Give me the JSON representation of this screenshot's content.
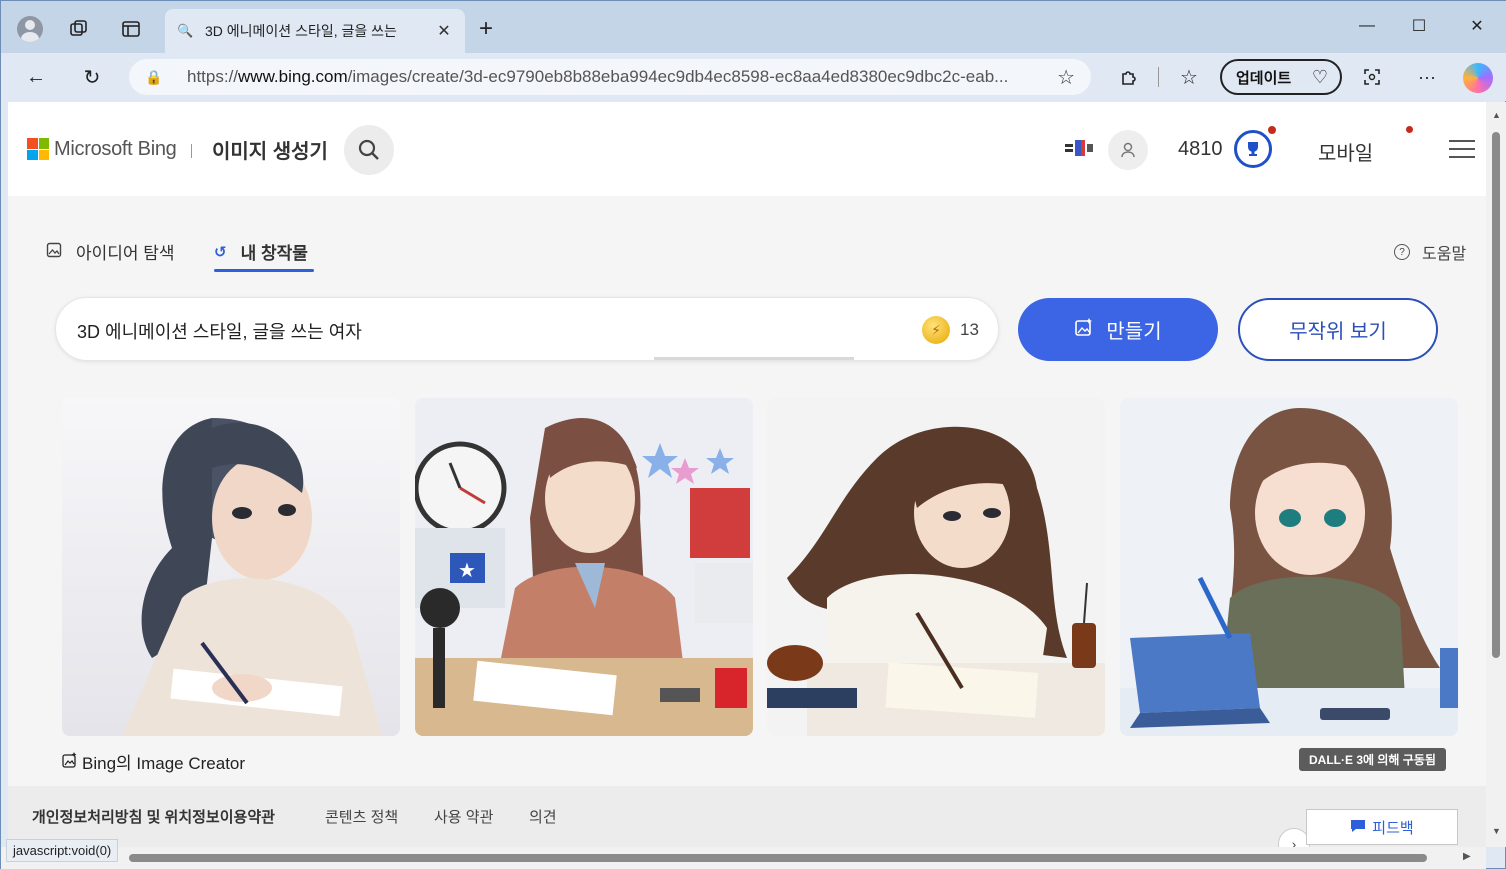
{
  "browser": {
    "tab_title": "3D 에니메이션 스타일, 글을 쓰는",
    "url_prefix": "https://",
    "url_domain": "www.bing.com",
    "url_rest": "/images/create/3d-ec9790eb8b88eba994ec9db4ec8598-ec8aa4ed8380ec9dbc2c-eab...",
    "update_label": "업데이트",
    "status_text": "javascript:void(0)"
  },
  "header": {
    "brand": "Microsoft Bing",
    "product": "이미지 생성기",
    "points": "4810",
    "mobile": "모바일"
  },
  "subnav": {
    "explore": "아이디어 탐색",
    "creations": "내 창작물",
    "help": "도움말"
  },
  "prompt": {
    "text": "3D 에니메이션 스타일, 글을 쓰는 여자",
    "boosts": "13",
    "create_label": "만들기",
    "random_label": "무작위 보기"
  },
  "results": {
    "credit": "Bing의 Image Creator",
    "badge": "DALL·E 3에 의해 구동됨"
  },
  "footer": {
    "privacy": "개인정보처리방침 및 위치정보이용약관",
    "content_policy": "콘텐츠 정책",
    "terms": "사용 약관",
    "opinion": "의견",
    "feedback": "피드백"
  },
  "colors": {
    "accent": "#3b65e4",
    "ms_red": "#f25022",
    "ms_green": "#7fba00",
    "ms_blue": "#00a4ef",
    "ms_yellow": "#ffb900"
  }
}
